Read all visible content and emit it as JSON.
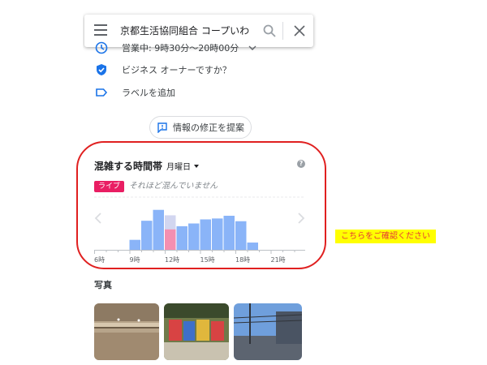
{
  "search": {
    "query": "京都生活協同組合 コープいわくら"
  },
  "info": {
    "hours": "営業中: 9時30分～20時00分",
    "owner": "ビジネス オーナーですか？",
    "label": "ラベルを追加",
    "suggest_edit": "情報の修正を提案"
  },
  "popular_times": {
    "title": "混雑する時間帯",
    "day": "月曜日",
    "help": "?",
    "live_badge": "ライブ",
    "live_status": "それほど混んでいません"
  },
  "photos": {
    "title": "写真"
  },
  "annotation": {
    "note": "こちらをご確認ください"
  },
  "colors": {
    "bar": "#8ab4f8",
    "live_bar": "#f48fb1",
    "live_ghost": "#d2d6f0",
    "badge": "#e91e63",
    "oval": "#e02020"
  },
  "chart_data": {
    "type": "bar",
    "x_labels": [
      "6時",
      "9時",
      "12時",
      "15時",
      "18時",
      "21時"
    ],
    "hours": [
      6,
      7,
      8,
      9,
      10,
      11,
      12,
      13,
      14,
      15,
      16,
      17,
      18,
      19,
      20,
      21,
      22,
      23
    ],
    "values": [
      0,
      0,
      0,
      0.22,
      0.64,
      0.88,
      0.58,
      0.52,
      0.58,
      0.67,
      0.69,
      0.75,
      0.63,
      0.16,
      0,
      0,
      0,
      0
    ],
    "live": {
      "hour": 12,
      "value": 0.45,
      "usual": 0.76
    },
    "ylim": [
      0,
      1
    ]
  }
}
